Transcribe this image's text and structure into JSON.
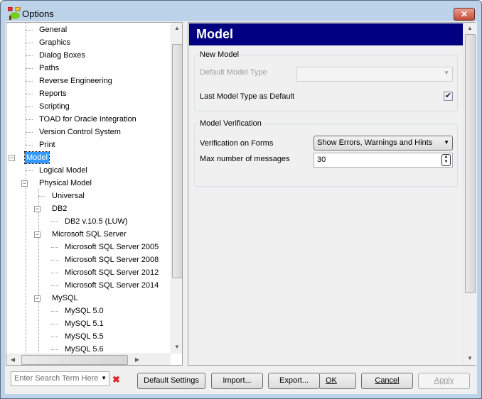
{
  "window": {
    "title": "Options",
    "close": "✕"
  },
  "tree": {
    "items": [
      {
        "label": "General",
        "level": 2,
        "selected": false
      },
      {
        "label": "Graphics",
        "level": 2,
        "selected": false
      },
      {
        "label": "Dialog Boxes",
        "level": 2,
        "selected": false
      },
      {
        "label": "Paths",
        "level": 2,
        "selected": false
      },
      {
        "label": "Reverse Engineering",
        "level": 2,
        "selected": false
      },
      {
        "label": "Reports",
        "level": 2,
        "selected": false
      },
      {
        "label": "Scripting",
        "level": 2,
        "selected": false
      },
      {
        "label": "TOAD for Oracle Integration",
        "level": 2,
        "selected": false
      },
      {
        "label": "Version Control System",
        "level": 2,
        "selected": false
      },
      {
        "label": "Print",
        "level": 2,
        "selected": false
      },
      {
        "label": "Model",
        "level": 1,
        "selected": true,
        "expander": "−"
      },
      {
        "label": "Logical Model",
        "level": 2,
        "selected": false
      },
      {
        "label": "Physical Model",
        "level": 2,
        "selected": false,
        "expander": "−"
      },
      {
        "label": "Universal",
        "level": 3,
        "selected": false
      },
      {
        "label": "DB2",
        "level": 3,
        "selected": false,
        "expander": "−"
      },
      {
        "label": "DB2 v.10.5 (LUW)",
        "level": 4,
        "selected": false
      },
      {
        "label": "Microsoft SQL Server",
        "level": 3,
        "selected": false,
        "expander": "−"
      },
      {
        "label": "Microsoft SQL Server 2005",
        "level": 4,
        "selected": false
      },
      {
        "label": "Microsoft SQL Server 2008",
        "level": 4,
        "selected": false
      },
      {
        "label": "Microsoft SQL Server 2012",
        "level": 4,
        "selected": false
      },
      {
        "label": "Microsoft SQL Server 2014",
        "level": 4,
        "selected": false
      },
      {
        "label": "MySQL",
        "level": 3,
        "selected": false,
        "expander": "−"
      },
      {
        "label": "MySQL 5.0",
        "level": 4,
        "selected": false
      },
      {
        "label": "MySQL 5.1",
        "level": 4,
        "selected": false
      },
      {
        "label": "MySQL 5.5",
        "level": 4,
        "selected": false
      },
      {
        "label": "MySQL 5.6",
        "level": 4,
        "selected": false
      }
    ]
  },
  "panel": {
    "title": "Model",
    "new_model": {
      "group": "New Model",
      "default_type_label": "Default Model Type",
      "default_type_value": "",
      "last_type_label": "Last Model Type as Default",
      "last_type_checked": true
    },
    "verification": {
      "group": "Model Verification",
      "forms_label": "Verification on Forms",
      "forms_value": "Show Errors, Warnings and Hints",
      "max_label": "Max number of messages",
      "max_value": "30"
    }
  },
  "footer": {
    "search_placeholder": "Enter Search Term Here",
    "default_settings": "Default Settings",
    "import": "Import...",
    "export": "Export...",
    "ok": "OK",
    "cancel": "Cancel",
    "apply": "Apply"
  }
}
